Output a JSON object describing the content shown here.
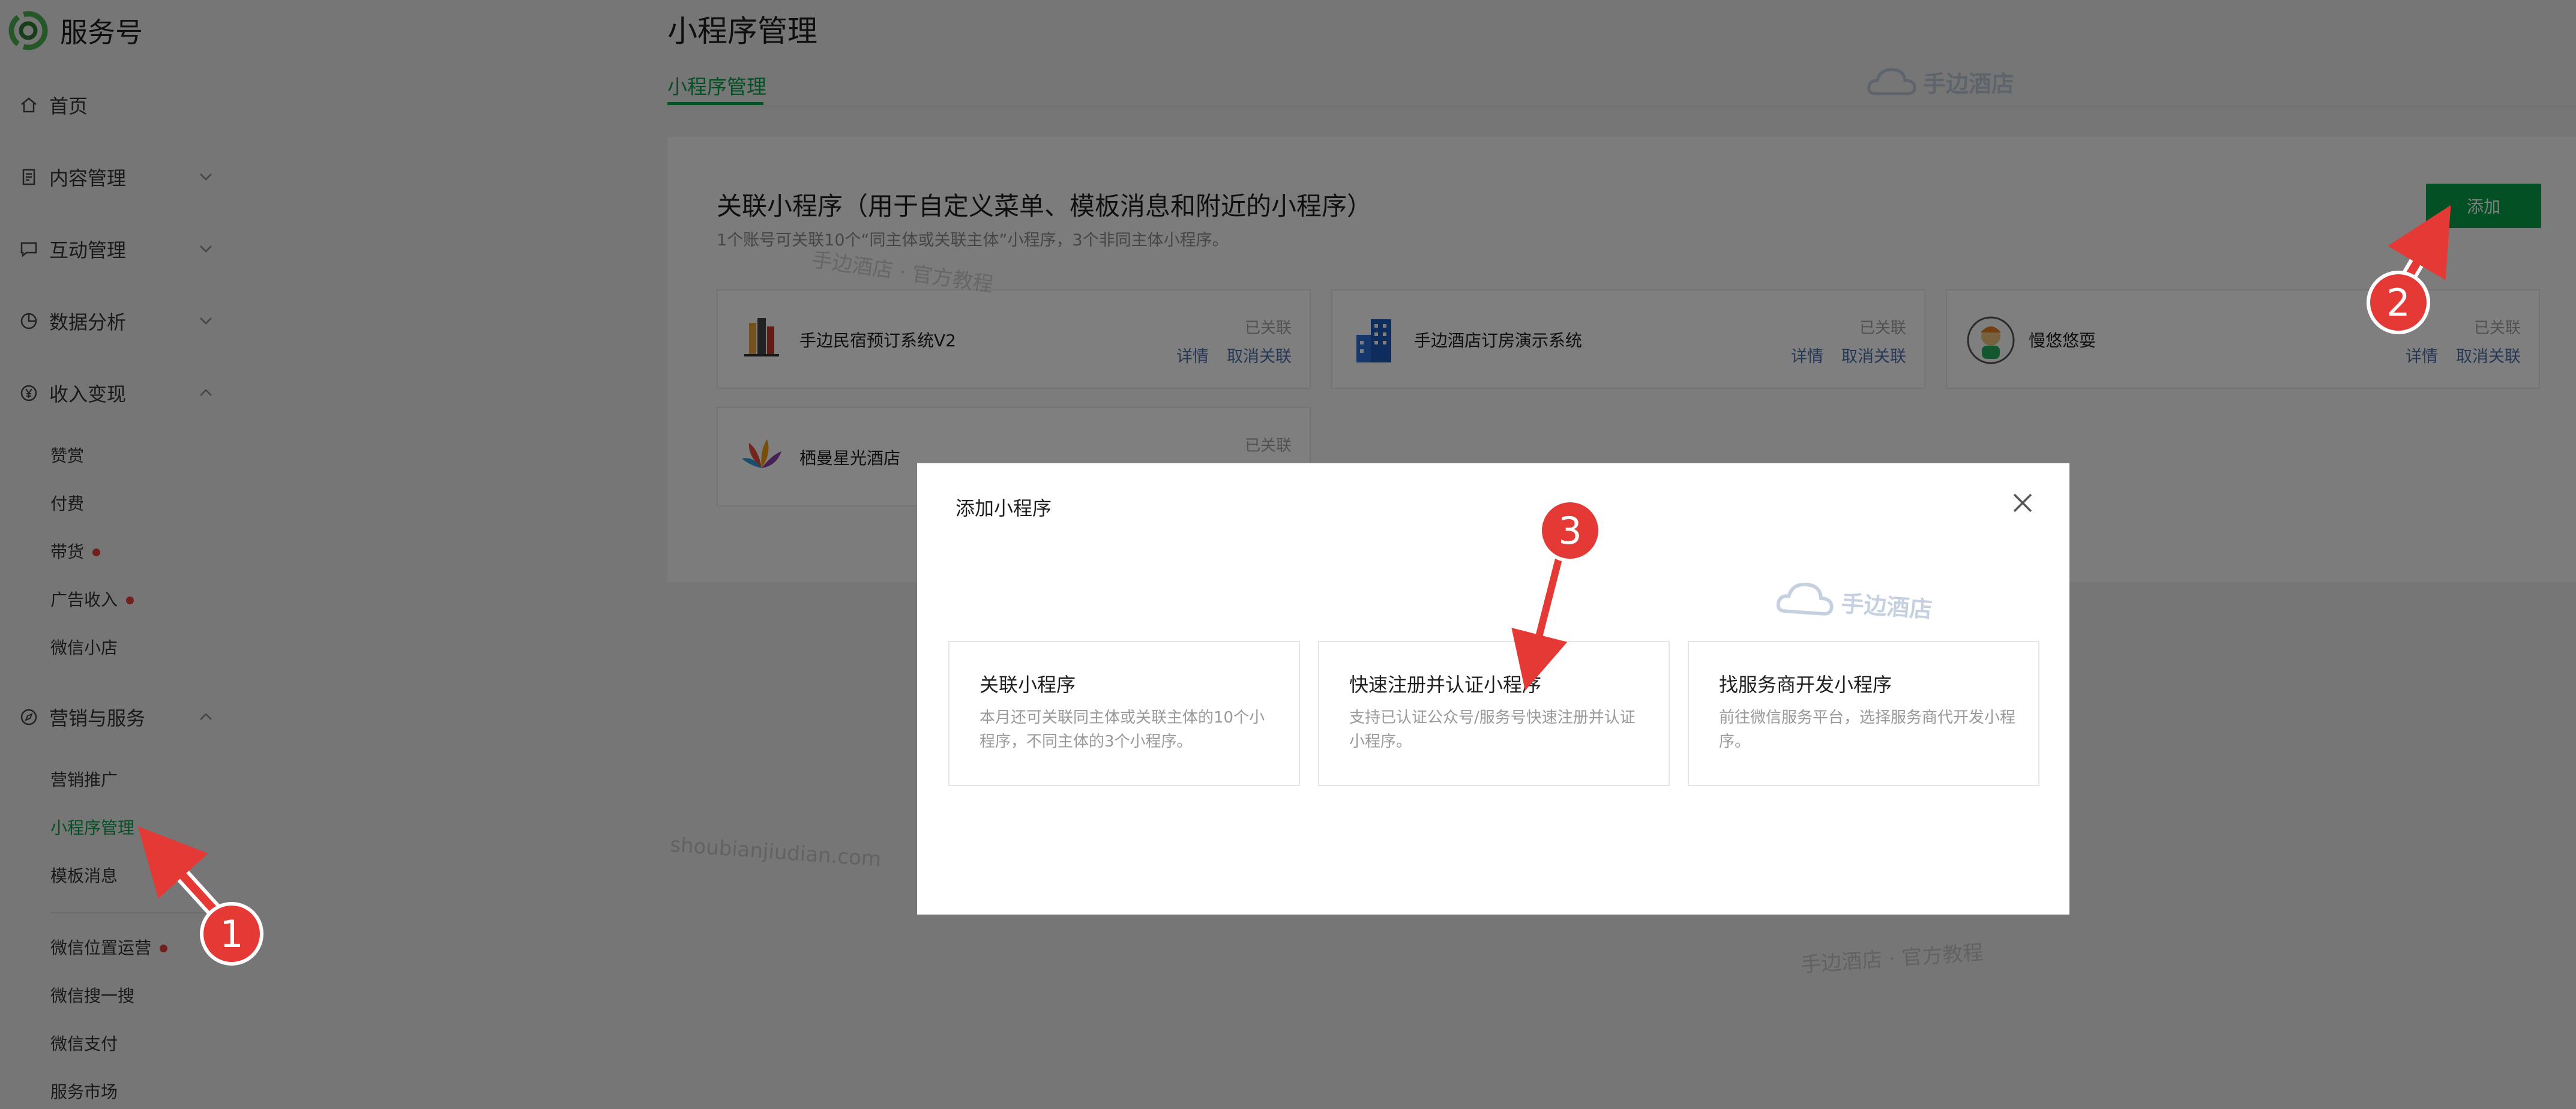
{
  "app": {
    "name": "服务号"
  },
  "sidebar": {
    "home": "首页",
    "content": "内容管理",
    "interaction": "互动管理",
    "analytics": "数据分析",
    "revenue": "收入变现",
    "revenue_items": [
      "赞赏",
      "付费",
      "带货",
      "广告收入",
      "微信小店"
    ],
    "marketing": "营销与服务",
    "marketing_items": [
      "营销推广",
      "小程序管理",
      "模板消息"
    ],
    "more_items": [
      "微信位置运营",
      "微信搜一搜",
      "微信支付",
      "服务市场"
    ]
  },
  "page": {
    "title": "小程序管理",
    "tab": "小程序管理"
  },
  "panel": {
    "title": "关联小程序（用于自定义菜单、模板消息和附近的小程序）",
    "desc": "1个账号可关联10个“同主体或关联主体”小程序，3个非同主体小程序。",
    "add_label": "添加",
    "status_linked": "已关联",
    "detail_label": "详情",
    "unlink_label": "取消关联",
    "miniprograms": [
      {
        "name": "手边民宿预订系统V2",
        "icon": "building-logo-icon"
      },
      {
        "name": "手边酒店订房演示系统",
        "icon": "blue-building-icon"
      },
      {
        "name": "慢悠悠耍",
        "icon": "cartoon-avatar-icon"
      },
      {
        "name": "栖曼星光酒店",
        "icon": "colorful-flower-icon"
      }
    ]
  },
  "modal": {
    "title": "添加小程序",
    "options": [
      {
        "title": "关联小程序",
        "desc": "本月还可关联同主体或关联主体的10个小程序，不同主体的3个小程序。"
      },
      {
        "title": "快速注册并认证小程序",
        "desc": "支持已认证公众号/服务号快速注册并认证小程序。"
      },
      {
        "title": "找服务商开发小程序",
        "desc": "前往微信服务平台，选择服务商代开发小程序。"
      }
    ]
  },
  "watermarks": {
    "brand": "手边酒店",
    "tagline": "手边酒店 · 官方教程",
    "url": "shoubianjiudian.com"
  },
  "annotations": [
    "1",
    "2",
    "3"
  ],
  "colors": {
    "accent": "#07a04a",
    "link": "#4d6ea8",
    "dot": "#e5403a",
    "arrow": "#e53935"
  }
}
